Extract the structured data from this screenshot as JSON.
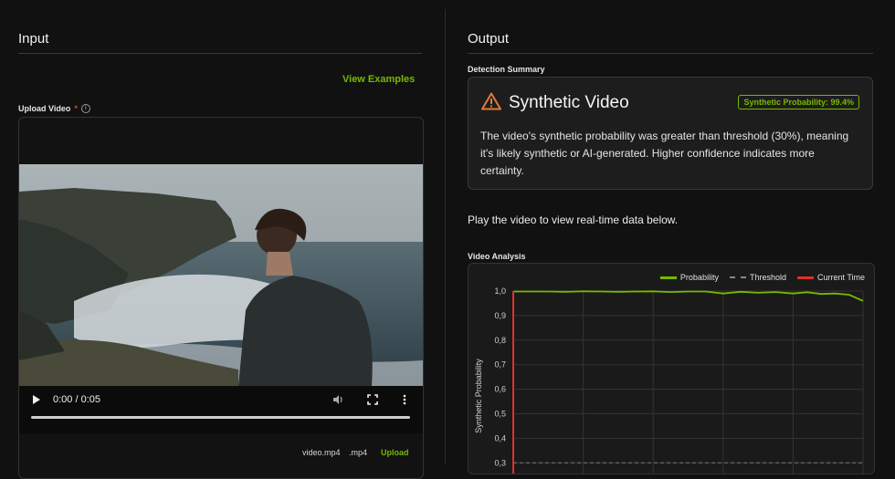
{
  "input": {
    "title": "Input",
    "view_examples": "View Examples",
    "upload_label": "Upload Video",
    "required_mark": "*",
    "info_icon": "i",
    "player": {
      "time": "0:00 / 0:05"
    },
    "file_name": "video.mp4",
    "file_ext": ".mp4",
    "upload_button": "Upload"
  },
  "output": {
    "title": "Output",
    "summary_label": "Detection Summary",
    "summary_title": "Synthetic Video",
    "probability_badge": "Synthetic Probability: 99.4%",
    "summary_text": "The video's synthetic probability was greater than threshold (30%), meaning it's likely synthetic or AI-generated. Higher confidence indicates more certainty.",
    "play_hint": "Play the video to view real-time data below.",
    "analysis_label": "Video Analysis"
  },
  "colors": {
    "accent": "#76b900",
    "warning": "#e07b39",
    "current_time": "#e0302a"
  },
  "chart_data": {
    "type": "line",
    "ylabel": "Synthetic Probability",
    "ylim": [
      0.3,
      1.0
    ],
    "yticks": [
      "1,0",
      "0,9",
      "0,8",
      "0,7",
      "0,6",
      "0,5",
      "0,4",
      "0,3"
    ],
    "legend": [
      "Probability",
      "Threshold",
      "Current Time"
    ],
    "grid": true,
    "series": [
      {
        "name": "Probability",
        "x": [
          0,
          0.25,
          0.5,
          0.75,
          1.0,
          1.25,
          1.5,
          1.75,
          2.0,
          2.25,
          2.5,
          2.75,
          3.0,
          3.25,
          3.5,
          3.75,
          4.0,
          4.2,
          4.4,
          4.6,
          4.8,
          5.0
        ],
        "values": [
          0.998,
          0.998,
          0.998,
          0.997,
          0.999,
          0.998,
          0.997,
          0.998,
          0.999,
          0.996,
          0.998,
          0.998,
          0.99,
          0.997,
          0.993,
          0.996,
          0.99,
          0.995,
          0.988,
          0.99,
          0.985,
          0.96
        ]
      }
    ],
    "threshold": 0.3,
    "current_time": 0
  }
}
